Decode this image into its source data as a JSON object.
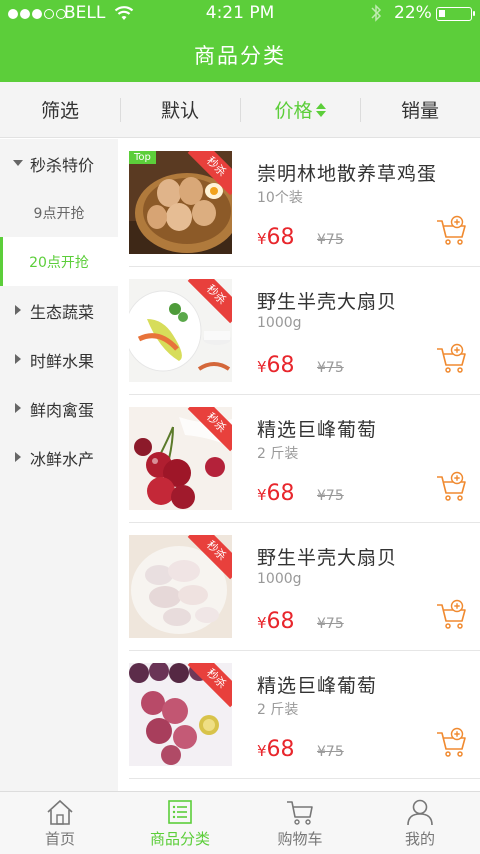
{
  "status_bar": {
    "carrier": "BELL",
    "time": "4:21 PM",
    "battery_text": "22%",
    "battery_level": 0.22
  },
  "header": {
    "title": "商品分类"
  },
  "filters": [
    {
      "label": "筛选"
    },
    {
      "label": "默认"
    },
    {
      "label": "价格",
      "active": true
    },
    {
      "label": "销量"
    }
  ],
  "sidebar": {
    "group": "秒杀特价",
    "sub_items": [
      "9点开抢",
      "20点开抢"
    ],
    "categories": [
      "生态蔬菜",
      "时鲜水果",
      "鲜肉禽蛋",
      "冰鲜水产"
    ]
  },
  "products": [
    {
      "name": "崇明林地散养草鸡蛋",
      "spec": "10个装",
      "currency": "¥",
      "price": "68",
      "original_price": "¥75",
      "ribbon": "秒杀",
      "tag": "Top",
      "image": "eggs-basket"
    },
    {
      "name": "野生半壳大扇贝",
      "spec": "1000g",
      "currency": "¥",
      "price": "68",
      "original_price": "¥75",
      "ribbon": "秒杀",
      "image": "shrimp-plate"
    },
    {
      "name": "精选巨峰葡萄",
      "spec": "2 斤装",
      "currency": "¥",
      "price": "68",
      "original_price": "¥75",
      "ribbon": "秒杀",
      "image": "cherries"
    },
    {
      "name": "野生半壳大扇贝",
      "spec": "1000g",
      "currency": "¥",
      "price": "68",
      "original_price": "¥75",
      "ribbon": "秒杀",
      "image": "peeled-shrimp"
    },
    {
      "name": "精选巨峰葡萄",
      "spec": "2 斤装",
      "currency": "¥",
      "price": "68",
      "original_price": "¥75",
      "ribbon": "秒杀",
      "image": "grapes"
    }
  ],
  "tabbar": [
    {
      "label": "首页",
      "icon": "home-icon"
    },
    {
      "label": "商品分类",
      "icon": "list-icon",
      "active": true
    },
    {
      "label": "购物车",
      "icon": "cart-icon"
    },
    {
      "label": "我的",
      "icon": "user-icon"
    }
  ],
  "colors": {
    "brand": "#5cce3a",
    "price": "#e8262c",
    "ribbon": "#e8403c",
    "cart": "#f08a30"
  }
}
